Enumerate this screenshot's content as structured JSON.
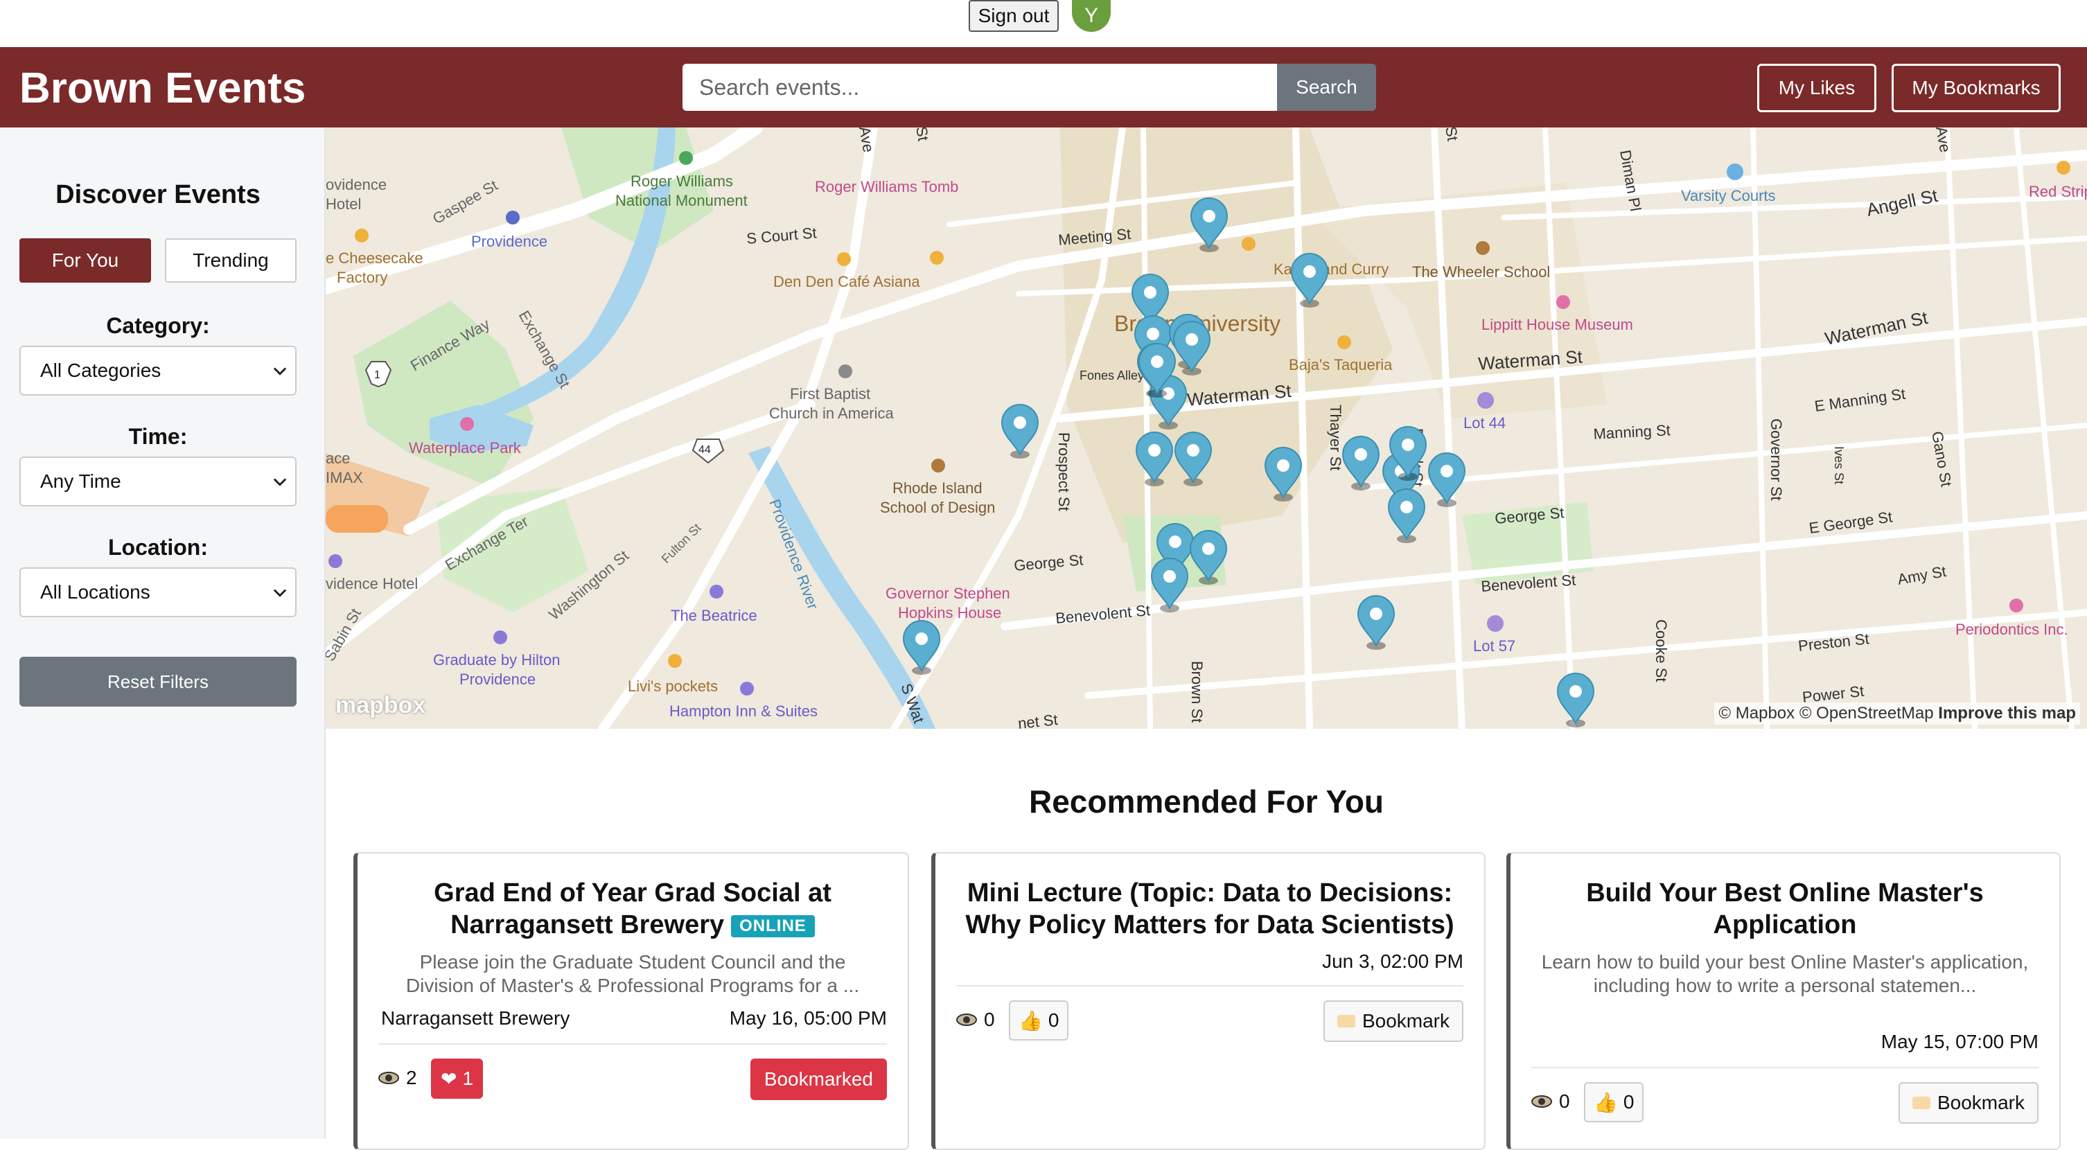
{
  "user": {
    "sign_out_label": "Sign out",
    "avatar_initial": "Y"
  },
  "header": {
    "brand": "Brown Events",
    "search_placeholder": "Search events...",
    "search_label": "Search",
    "my_likes_label": "My Likes",
    "my_bookmarks_label": "My Bookmarks",
    "brand_color": "#7b2a2a"
  },
  "sidebar": {
    "title": "Discover Events",
    "tabs": [
      {
        "label": "For You",
        "active": true
      },
      {
        "label": "Trending",
        "active": false
      }
    ],
    "category": {
      "label": "Category:",
      "value": "All Categories"
    },
    "time": {
      "label": "Time:",
      "value": "Any Time"
    },
    "location": {
      "label": "Location:",
      "value": "All Locations"
    },
    "reset_label": "Reset Filters"
  },
  "map": {
    "labels": {
      "providence_hotel": "ovidence",
      "providence_hotel2": "Hotel",
      "gaspee": "Gaspee St",
      "rwnm1": "Roger Williams",
      "rwnm2": "National Monument",
      "providence_station": "Providence",
      "cheesecake1": "e Cheesecake",
      "cheesecake2": "Factory",
      "finance": "Finance Way",
      "exchange": "Exchange St",
      "waterplace": "Waterplace Park",
      "imax1": "ace",
      "imax2": "IMAX",
      "exchange_ter": "Exchange Ter",
      "washington": "Washington St",
      "fulton": "Fulton St",
      "providence_hotel3": "vidence Hotel",
      "sabin": "Sabin St",
      "beatrice": "The Beatrice",
      "graduate1": "Graduate by Hilton",
      "graduate2": "Providence",
      "livis": "Livi's pockets",
      "hampton": "Hampton Inn & Suites",
      "river": "Providence River",
      "rw_tomb": "Roger Williams Tomb",
      "s_court": "S Court St",
      "den_den": "Den Den Café Asiana",
      "first_baptist1": "First Baptist",
      "first_baptist2": "Church in America",
      "risd1": "Rhode Island",
      "risd2": "School of Design",
      "prospect": "Prospect St",
      "george": "George St",
      "governor1": "Governor Stephen",
      "governor2": "Hopkins House",
      "benevolent": "Benevolent St",
      "s_water": "S Wat",
      "brown_st": "Brown St",
      "meeting": "Meeting St",
      "brown_univ": "Brown University",
      "fones": "Fones Alley",
      "waterman": "Waterman St",
      "kabob": "Kabob and Curry",
      "bajas": "Baja's Taqueria",
      "thayer": "Thayer St",
      "brook": "Brook St",
      "wheeler": "The Wheeler School",
      "lippitt": "Lippitt House Museum",
      "waterman2": "Waterman St",
      "lot44": "Lot 44",
      "george2": "George St",
      "benevolent2": "Benevolent St",
      "lot57": "Lot 57",
      "cooke": "Cooke St",
      "diman": "Diman Pl",
      "varsity": "Varsity Courts",
      "angell": "Angell St",
      "red_stripe": "Red Strip",
      "waterman3": "Waterman St",
      "e_manning": "E Manning St",
      "manning": "Manning St",
      "governor_st": "Governor St",
      "ives": "Ives St",
      "gano": "Gano St",
      "e_george": "E George St",
      "amy": "Amy St",
      "periodontics": "Periodontics Inc.",
      "preston": "Preston St",
      "power": "Power St",
      "net_st": "net St",
      "ave": "Ave",
      "st_top": "St",
      "st_top2": "St",
      "ave2": "Ave"
    },
    "marker_count": 24,
    "logo": "mapbox",
    "attribution": "© Mapbox © OpenStreetMap",
    "improve": "Improve this map"
  },
  "recommended": {
    "title": "Recommended For You",
    "cards": [
      {
        "title_line1": "Grad End of Year Grad Social at",
        "title_line2": "Narragansett Brewery",
        "badge": "ONLINE",
        "desc": "Please join the Graduate Student Council and the Division of Master's & Professional Programs for a ...",
        "location": "Narragansett Brewery",
        "time": "May 16, 05:00 PM",
        "views": "2",
        "likes": "1",
        "liked": true,
        "bookmark_label": "Bookmarked"
      },
      {
        "title_line1": "Mini Lecture (Topic: Data to Decisions:",
        "title_line2": "Why Policy Matters for Data Scientists)",
        "time": "Jun 3, 02:00 PM",
        "views": "0",
        "likes": "0",
        "bookmark_label": "Bookmark"
      },
      {
        "title_line1": "Build Your Best Online Master's",
        "title_line2": "Application",
        "desc": "Learn how to build your best Online Master's application, including how to write a personal statemen...",
        "time": "May 15, 07:00 PM",
        "views": "0",
        "likes": "0",
        "bookmark_label": "Bookmark"
      }
    ]
  }
}
